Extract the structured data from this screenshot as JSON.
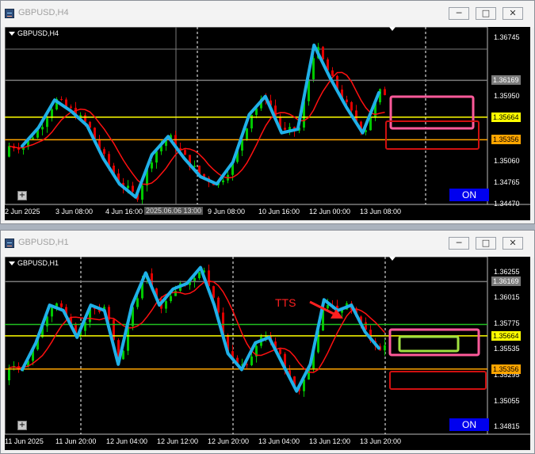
{
  "windows": [
    {
      "title": "GBPUSD,H4",
      "symbol_label": "GBPUSD,H4",
      "on_label": "ON",
      "min_label": "─",
      "max_label": "□",
      "close_label": "✕",
      "plus_label": "+",
      "crosshair_time": "2025.06.06 13:00",
      "chart_data": {
        "type": "candlestick",
        "timeframe": "H4",
        "ylim": [
          1.3447,
          1.369
        ],
        "price_ticks": [
          "1.36745",
          "1.35950",
          "1.35060",
          "1.34765",
          "1.34470"
        ],
        "time_labels": [
          "2 Jun 2025",
          "3 Jun 08:00",
          "4 Jun 16:00",
          "9 Jun 08:00",
          "10 Jun 16:00",
          "12 Jun 00:00",
          "13 Jun 08:00"
        ],
        "hlines": [
          {
            "price": 1.36169,
            "label": "1.36169",
            "color": "#7a7a7a"
          },
          {
            "price": 1.35664,
            "label": "1.35664",
            "color": "#ffff00"
          },
          {
            "price": 1.35356,
            "label": "1.35356",
            "color": "#ffa500"
          }
        ],
        "trace_prices": [
          1.3527,
          1.3552,
          1.359,
          1.3575,
          1.3555,
          1.351,
          1.3475,
          1.3457,
          1.3515,
          1.354,
          1.351,
          1.3485,
          1.3475,
          1.3505,
          1.357,
          1.3595,
          1.3545,
          1.355,
          1.3665,
          1.362,
          1.358,
          1.3545,
          1.36
        ],
        "colors": {
          "bull": "#00c800",
          "bear": "#e00000",
          "ma": "#ff1010",
          "trace": "#1fb0e8",
          "box_pink": "#ff5a9a",
          "box_red": "#d01010"
        }
      }
    },
    {
      "title": "GBPUSD,H1",
      "symbol_label": "GBPUSD,H1",
      "on_label": "ON",
      "min_label": "─",
      "max_label": "□",
      "close_label": "✕",
      "plus_label": "+",
      "annotation": "TTS",
      "chart_data": {
        "type": "candlestick",
        "timeframe": "H1",
        "ylim": [
          1.3475,
          1.364
        ],
        "price_ticks": [
          "1.36255",
          "1.36015",
          "1.35775",
          "1.35535",
          "1.35295",
          "1.35055",
          "1.34815"
        ],
        "time_labels": [
          "11 Jun 2025",
          "11 Jun 20:00",
          "12 Jun 04:00",
          "12 Jun 12:00",
          "12 Jun 20:00",
          "13 Jun 04:00",
          "13 Jun 12:00",
          "13 Jun 20:00"
        ],
        "hlines": [
          {
            "price": 1.36169,
            "label": "1.36169",
            "color": "#7a7a7a"
          },
          {
            "price": 1.3577,
            "label": "",
            "color": "#20c020"
          },
          {
            "price": 1.35664,
            "label": "1.35664",
            "color": "#ffff00"
          },
          {
            "price": 1.35356,
            "label": "1.35356",
            "color": "#ffa500"
          }
        ],
        "trace_prices": [
          1.3535,
          1.356,
          1.3595,
          1.359,
          1.3565,
          1.3595,
          1.359,
          1.354,
          1.3595,
          1.3625,
          1.3595,
          1.361,
          1.3615,
          1.363,
          1.3595,
          1.355,
          1.3535,
          1.356,
          1.3565,
          1.354,
          1.3515,
          1.354,
          1.36,
          1.359,
          1.3595,
          1.357,
          1.3555
        ],
        "colors": {
          "bull": "#00c800",
          "bear": "#e00000",
          "ma": "#ff1010",
          "trace": "#1fb0e8",
          "box_pink": "#ff5a9a",
          "box_red": "#d01010",
          "box_green": "#a0e040"
        }
      }
    }
  ]
}
